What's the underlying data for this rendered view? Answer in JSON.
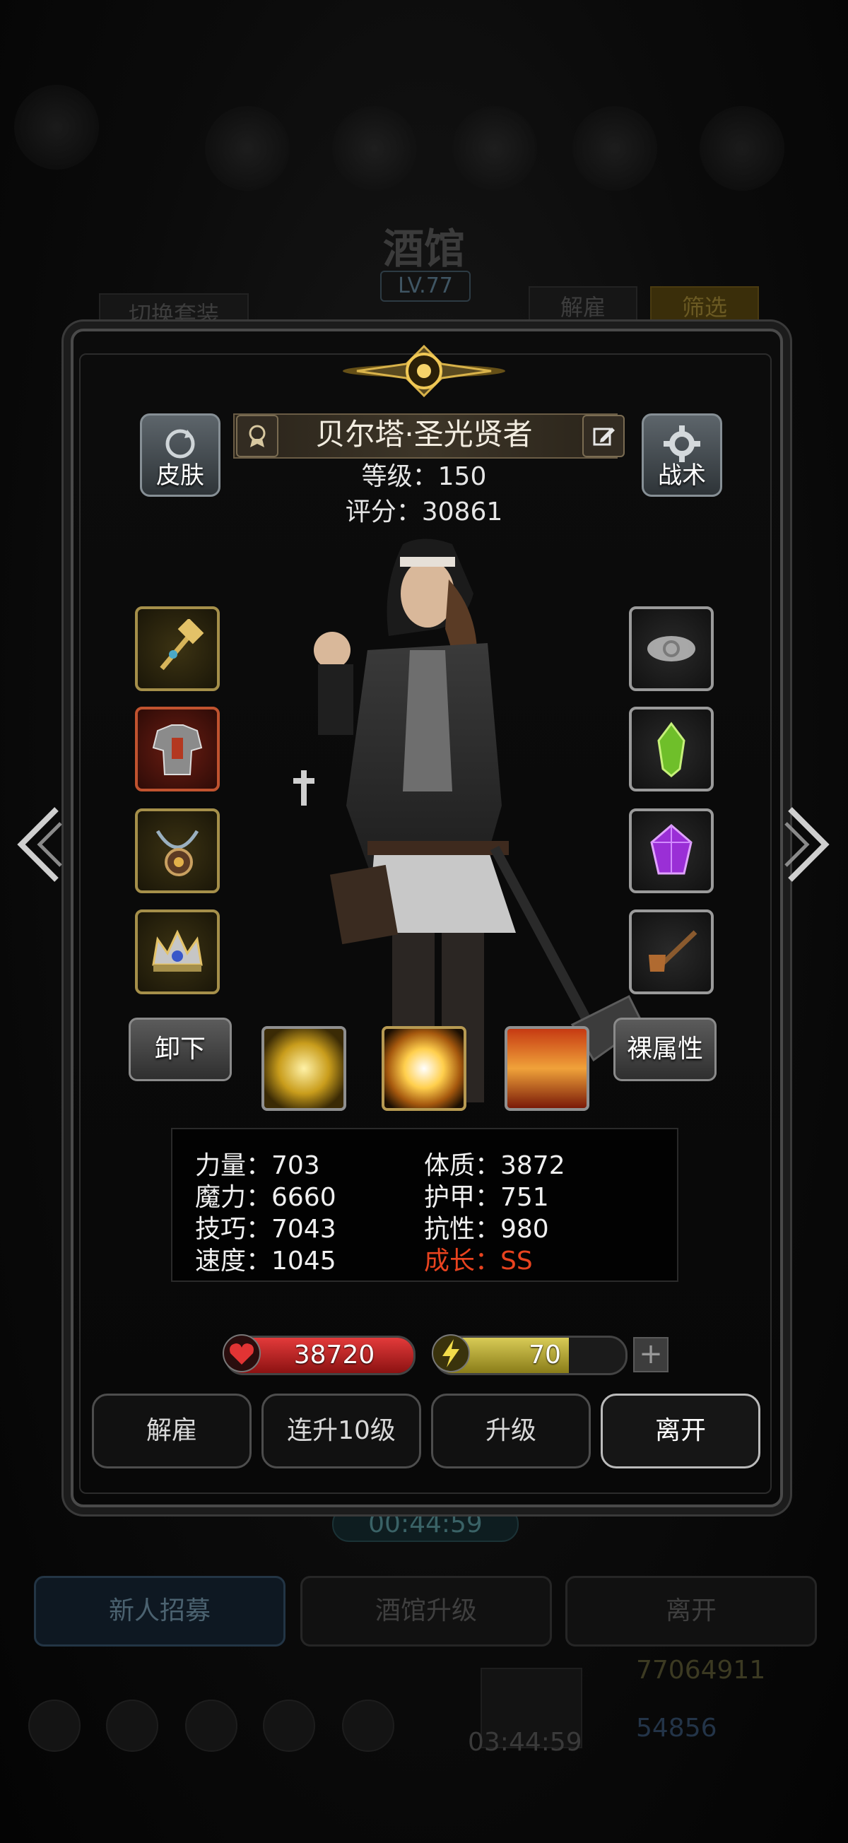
{
  "background": {
    "title": "酒馆",
    "level": "LV.77",
    "switch_set_label": "切换套装",
    "dismiss_label": "解雇",
    "filter_label": "筛选",
    "timer": "00:44:59",
    "bottom_tabs": [
      "新人招募",
      "酒馆升级",
      "离开"
    ],
    "gold": "77064911",
    "gems": "54856",
    "chest_timer": "03:44:59"
  },
  "hero": {
    "name": "贝尔塔·圣光贤者",
    "level_text": "等级：150",
    "score_text": "评分：30861"
  },
  "buttons": {
    "skin": "皮肤",
    "tactics": "战术",
    "unequip": "卸下",
    "base_attributes": "裸属性"
  },
  "equipment": {
    "left": [
      "hammer-scepter-icon",
      "armor-chest-icon",
      "amulet-chain-icon",
      "crown-icon"
    ],
    "right": [
      "cloud-ring-icon",
      "green-crystal-icon",
      "purple-gem-icon",
      "pipe-icon"
    ]
  },
  "attributes": {
    "strength": "力量：703",
    "constitution": "体质：3872",
    "magic": "魔力：6660",
    "armor": "护甲：751",
    "skill": "技巧：7043",
    "resistance": "抗性：980",
    "speed": "速度：1045",
    "growth": "成长：SS"
  },
  "bars": {
    "hp": "38720",
    "energy": "70",
    "energy_fraction": 0.7,
    "plus": "+"
  },
  "actions": [
    "解雇",
    "连升10级",
    "升级",
    "离开"
  ],
  "colors": {
    "growth": "#e8431f",
    "hp": "#d42b2b",
    "energy": "#c9bc45"
  }
}
